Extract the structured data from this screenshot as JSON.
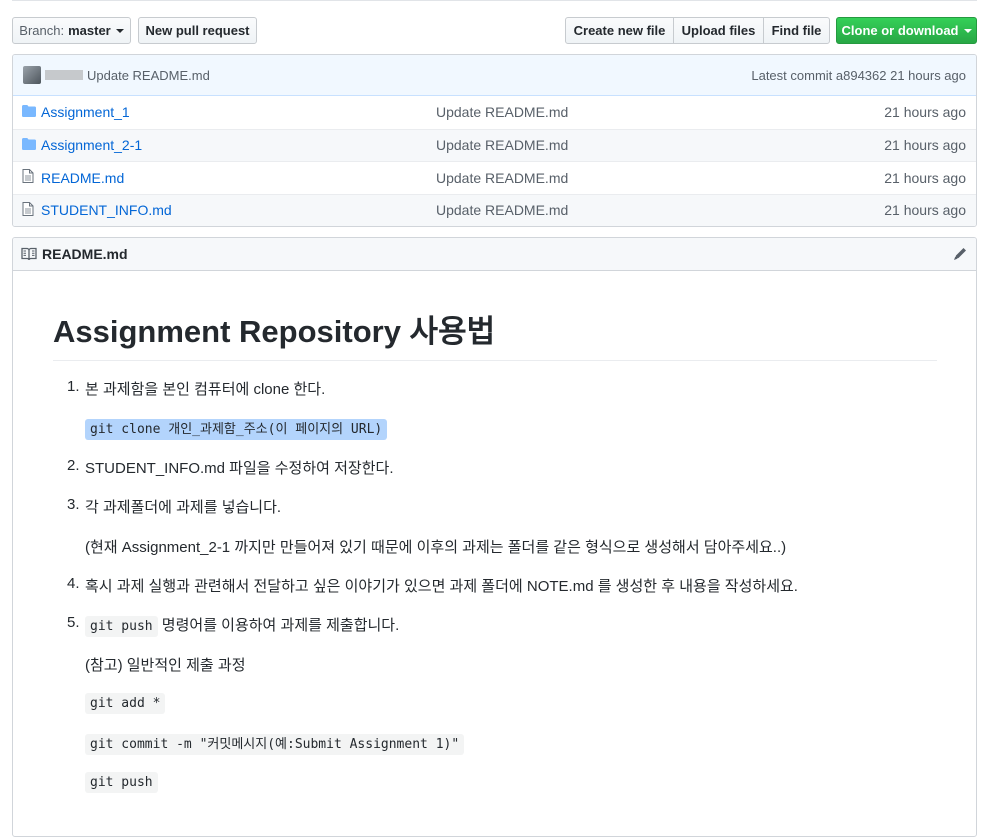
{
  "toolbar": {
    "branch_label": "Branch:",
    "branch_value": "master",
    "new_pr": "New pull request",
    "create_file": "Create new file",
    "upload_files": "Upload files",
    "find_file": "Find file",
    "clone_download": "Clone or download"
  },
  "commit": {
    "message": "Update README.md",
    "latest": "Latest commit a894362 21 hours ago"
  },
  "files": [
    {
      "name": "Assignment_1",
      "type": "folder",
      "message": "Update README.md",
      "age": "21 hours ago"
    },
    {
      "name": "Assignment_2-1",
      "type": "folder",
      "message": "Update README.md",
      "age": "21 hours ago"
    },
    {
      "name": "README.md",
      "type": "file",
      "message": "Update README.md",
      "age": "21 hours ago"
    },
    {
      "name": "STUDENT_INFO.md",
      "type": "file",
      "message": "Update README.md",
      "age": "21 hours ago"
    }
  ],
  "readme": {
    "header": "README.md",
    "title": "Assignment Repository 사용법",
    "step1": "본 과제함을 본인 컴퓨터에 clone 한다.",
    "step1_code": "git clone 개인_과제함_주소(이 페이지의 URL)",
    "step2": "STUDENT_INFO.md 파일을 수정하여 저장한다.",
    "step3": "각 과제폴더에 과제를 넣습니다.",
    "step3_note": "(현재 Assignment_2-1 까지만 만들어져 있기 때문에 이후의 과제는 폴더를 같은 형식으로 생성해서 담아주세요..)",
    "step4": "혹시 과제 실행과 관련해서 전달하고 싶은 이야기가 있으면 과제 폴더에 NOTE.md 를 생성한 후 내용을 작성하세요.",
    "step5_code": "git push",
    "step5_text": " 명령어를 이용하여 과제를 제출합니다.",
    "step5_note": "(참고) 일반적인 제출 과정",
    "cmd_add": "git add *",
    "cmd_commit": "git commit -m \"커밋메시지(예:Submit Assignment 1)\"",
    "cmd_push": "git push"
  }
}
